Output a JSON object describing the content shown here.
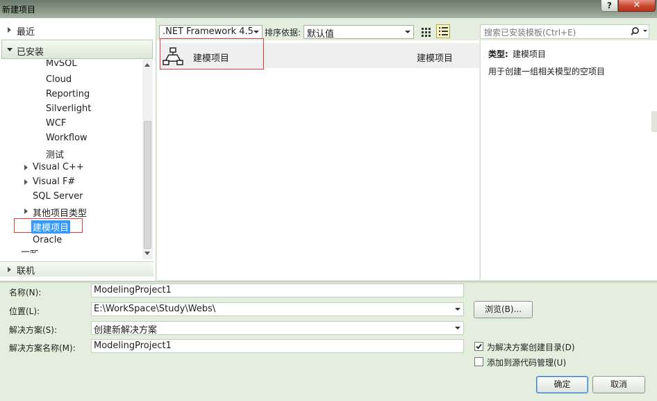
{
  "window": {
    "title": "新建项目",
    "help_label": "?",
    "close_label": "✕"
  },
  "sidebar": {
    "recent_label": "最近",
    "installed_label": "已安装",
    "online_label": "联机",
    "partial_top": "MySQL",
    "partial_bottom": "一起",
    "items": [
      {
        "label": "Cloud"
      },
      {
        "label": "Reporting"
      },
      {
        "label": "Silverlight"
      },
      {
        "label": "WCF"
      },
      {
        "label": "Workflow"
      },
      {
        "label": "测试"
      },
      {
        "label": "Visual C++"
      },
      {
        "label": "Visual F#"
      },
      {
        "label": "SQL Server"
      },
      {
        "label": "其他项目类型"
      },
      {
        "label": "建模项目"
      },
      {
        "label": "Oracle"
      }
    ]
  },
  "toolbar": {
    "framework_value": ".NET Framework 4.5",
    "sort_label": "排序依据:",
    "sort_value": "默认值",
    "search_placeholder": "搜索已安装模板(Ctrl+E)"
  },
  "templates": [
    {
      "name": "建模项目",
      "language": "建模项目"
    }
  ],
  "details": {
    "type_label": "类型:",
    "type_value": "建模项目",
    "description": "用于创建一组相关模型的空项目"
  },
  "form": {
    "name_label": "名称(N):",
    "name_value": "ModelingProject1",
    "location_label": "位置(L):",
    "location_value": "E:\\WorkSpace\\Study\\Webs\\",
    "browse_label": "浏览(B)...",
    "solution_label": "解决方案(S):",
    "solution_value": "创建新解决方案",
    "solution_name_label": "解决方案名称(M):",
    "solution_name_value": "ModelingProject1",
    "create_dir_label": "为解决方案创建目录(D)",
    "create_dir_checked": true,
    "source_control_label": "添加到源代码管理(U)",
    "source_control_checked": false,
    "ok_label": "确定",
    "cancel_label": "取消"
  }
}
